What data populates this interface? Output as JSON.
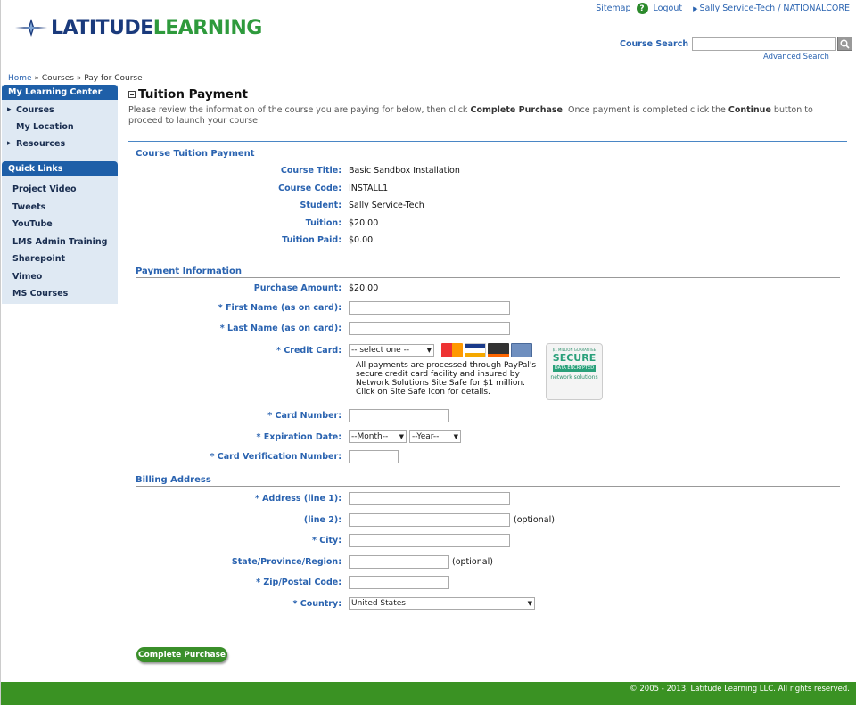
{
  "header": {
    "logo_lat": "LATITUDE",
    "logo_learn": "LEARNING",
    "sitemap": "Sitemap",
    "logout": "Logout",
    "user": "Sally Service-Tech / NATIONALCORE",
    "search_label": "Course Search",
    "advanced_search": "Advanced Search"
  },
  "breadcrumb": {
    "home": "Home",
    "sep": "»",
    "courses": "Courses",
    "current": "Pay for Course"
  },
  "sidebar": {
    "header": "My Learning Center",
    "items": [
      {
        "label": "Courses"
      },
      {
        "label": "My Location"
      },
      {
        "label": "Resources"
      }
    ],
    "quick_links_header": "Quick Links",
    "quick_links": [
      "Project Video",
      "Tweets",
      "YouTube",
      "LMS Admin Training",
      "Sharepoint",
      "Vimeo",
      "MS Courses"
    ]
  },
  "main": {
    "title": "Tuition Payment",
    "intro_1": "Please review the information of the course you are paying for below, then click",
    "intro_bold_1": "Complete Purchase",
    "intro_2": ". Once payment is completed click the",
    "intro_bold_2": "Continue",
    "intro_3": "button to proceed to launch your course."
  },
  "tuition": {
    "section": "Course Tuition Payment",
    "course_title_label": "Course Title:",
    "course_title": "Basic Sandbox Installation",
    "course_code_label": "Course Code:",
    "course_code": "INSTALL1",
    "student_label": "Student:",
    "student": "Sally Service-Tech",
    "tuition_label": "Tuition:",
    "tuition": "$20.00",
    "paid_label": "Tuition Paid:",
    "paid": "$0.00"
  },
  "payment": {
    "section": "Payment Information",
    "amount_label": "Purchase Amount:",
    "amount": "$20.00",
    "first_name_label": "* First Name (as on card):",
    "last_name_label": "* Last Name (as on card):",
    "credit_card_label": "* Credit Card:",
    "credit_card_select": "-- select one --",
    "paypal_note": "All payments are processed through PayPal's secure credit card facility and insured by Network Solutions Site Safe for $1 million. Click on Site Safe icon for details.",
    "seal_top": "$1 MILLION GUARANTEE",
    "seal_main": "SECURE",
    "seal_band": "DATA ENCRYPTED",
    "seal_brand": "network solutions",
    "card_number_label": "* Card Number:",
    "expiration_label": "* Expiration Date:",
    "month_select": "--Month--",
    "year_select": "--Year--",
    "cvn_label": "* Card Verification Number:"
  },
  "billing": {
    "section": "Billing Address",
    "address1_label": "* Address (line 1):",
    "address2_label": "(line 2):",
    "optional": "(optional)",
    "city_label": "* City:",
    "state_label": "State/Province/Region:",
    "zip_label": "* Zip/Postal Code:",
    "country_label": "* Country:",
    "country_value": "United States"
  },
  "actions": {
    "complete_purchase": "Complete Purchase"
  },
  "footer": {
    "copyright": "© 2005 - 2013, Latitude Learning LLC. All rights reserved."
  },
  "colors": {
    "link_blue": "#2a63b0",
    "sidebar_header": "#1e5fa8",
    "sidebar_bg": "#dfe9f3",
    "brand_green": "#3a9223"
  }
}
